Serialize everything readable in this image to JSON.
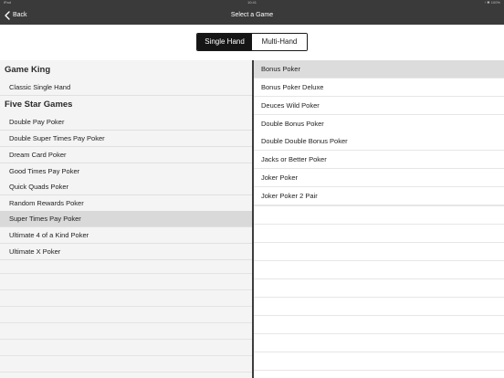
{
  "status_bar": {
    "left": "iPad",
    "time": "10:41",
    "right": "↑ ✱ 100%"
  },
  "nav": {
    "back_label": "Back",
    "title": "Select a Game"
  },
  "segments": [
    {
      "label": "Single Hand",
      "active": true
    },
    {
      "label": "Multi-Hand",
      "active": false
    }
  ],
  "left_sections": [
    {
      "header": "Game King",
      "items": [
        "Classic Single Hand"
      ]
    },
    {
      "header": "Five Star Games",
      "items": [
        "Double Pay Poker",
        "Double Super Times Pay Poker",
        "Dream Card Poker",
        "Good Times Pay Poker",
        "Quick Quads Poker",
        "Random Rewards Poker",
        "Super Times Pay Poker",
        "Ultimate 4 of a Kind Poker",
        "Ultimate X Poker"
      ]
    }
  ],
  "left_selected": "Super Times Pay Poker",
  "right_items": [
    "Bonus Poker",
    "Bonus Poker Deluxe",
    "Deuces Wild Poker",
    "Double Bonus Poker",
    "Double Double Bonus Poker",
    "Jacks or Better Poker",
    "Joker Poker",
    "Joker Poker 2 Pair"
  ],
  "right_selected": "Bonus Poker",
  "colors": {
    "nav_bg": "#3a3a3a",
    "selected_row": "#d9d9d9",
    "segment_active": "#151515"
  },
  "icons": {
    "back": "chevron-left-icon"
  }
}
